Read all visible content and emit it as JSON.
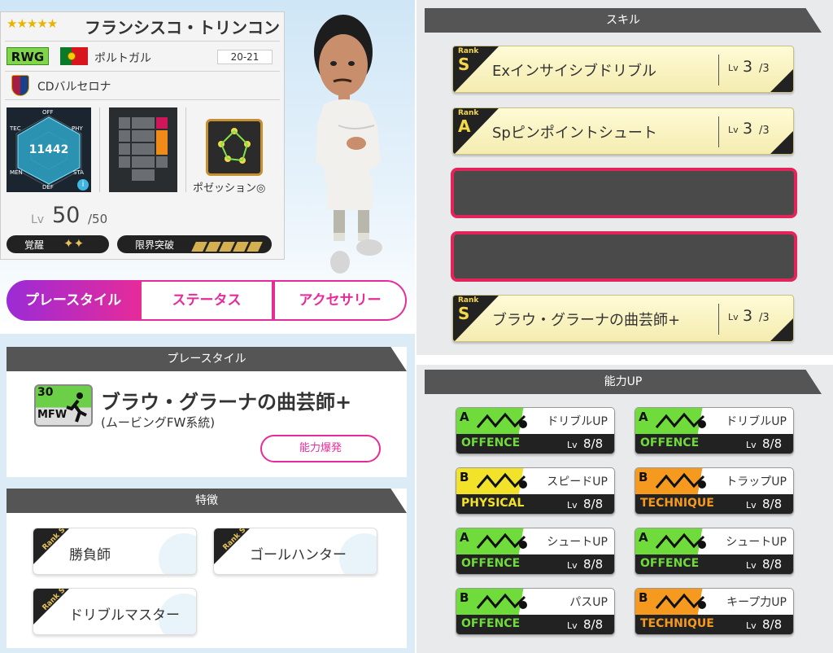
{
  "player": {
    "stars": "★★★★★",
    "name": "フランシスコ・トリンコン",
    "position": "RWG",
    "country": "ポルトガル",
    "season": "20-21",
    "club": "CDバルセロナ",
    "radar_total": "11442",
    "radar_labels": {
      "off": "OFF",
      "tec": "TEC",
      "phy": "PHY",
      "men": "MEN",
      "sta": "STA",
      "def": "DEF"
    },
    "possession_label": "ポゼッション◎",
    "level_label": "Lv",
    "level": "50",
    "level_max": "/50",
    "awaken_label": "覚醒",
    "awaken_marks": "✦✦",
    "limit_label": "限界突破"
  },
  "tabs": [
    "プレースタイル",
    "ステータス",
    "アクセサリー"
  ],
  "playstyle": {
    "header": "プレースタイル",
    "level": "30",
    "position": "MFW",
    "title": "ブラウ・グラーナの曲芸師+",
    "subtitle": "(ムービングFW系統)",
    "burst_button": "能力爆発"
  },
  "traits": {
    "header": "特徴",
    "rank_label": "Rank S",
    "items": [
      "勝負師",
      "ゴールハンター",
      "ドリブルマスター"
    ]
  },
  "skills": {
    "header": "スキル",
    "rank_word": "Rank",
    "lv_label": "Lv",
    "items": [
      {
        "rank": "S",
        "name": "Exインサイシブドリブル",
        "level": "3",
        "max": "/3"
      },
      {
        "rank": "A",
        "name": "Spピンポイントシュート",
        "level": "3",
        "max": "/3"
      },
      {
        "rank": "S",
        "name": "ブラウ・グラーナの曲芸師+",
        "level": "3",
        "max": "/3"
      }
    ]
  },
  "ability_up": {
    "header": "能力UP",
    "lv_label": "Lv",
    "items": [
      {
        "rank": "A",
        "name": "ドリブルUP",
        "category": "OFFENCE",
        "level": "8/8",
        "color": "#6fdc3c",
        "icon": "dribble-icon"
      },
      {
        "rank": "A",
        "name": "ドリブルUP",
        "category": "OFFENCE",
        "level": "8/8",
        "color": "#6fdc3c",
        "icon": "dribble-icon"
      },
      {
        "rank": "B",
        "name": "スピードUP",
        "category": "PHYSICAL",
        "level": "8/8",
        "color": "#f2e22a",
        "icon": "sprint-icon"
      },
      {
        "rank": "B",
        "name": "トラップUP",
        "category": "TECHNIQUE",
        "level": "8/8",
        "color": "#f59a1e",
        "icon": "trap-icon"
      },
      {
        "rank": "A",
        "name": "シュートUP",
        "category": "OFFENCE",
        "level": "8/8",
        "color": "#6fdc3c",
        "icon": "shoot-icon"
      },
      {
        "rank": "A",
        "name": "シュートUP",
        "category": "OFFENCE",
        "level": "8/8",
        "color": "#6fdc3c",
        "icon": "shoot-icon"
      },
      {
        "rank": "B",
        "name": "パスUP",
        "category": "OFFENCE",
        "level": "8/8",
        "color": "#6fdc3c",
        "icon": "pass-icon"
      },
      {
        "rank": "B",
        "name": "キープ力UP",
        "category": "TECHNIQUE",
        "level": "8/8",
        "color": "#f59a1e",
        "icon": "keep-icon"
      }
    ]
  }
}
